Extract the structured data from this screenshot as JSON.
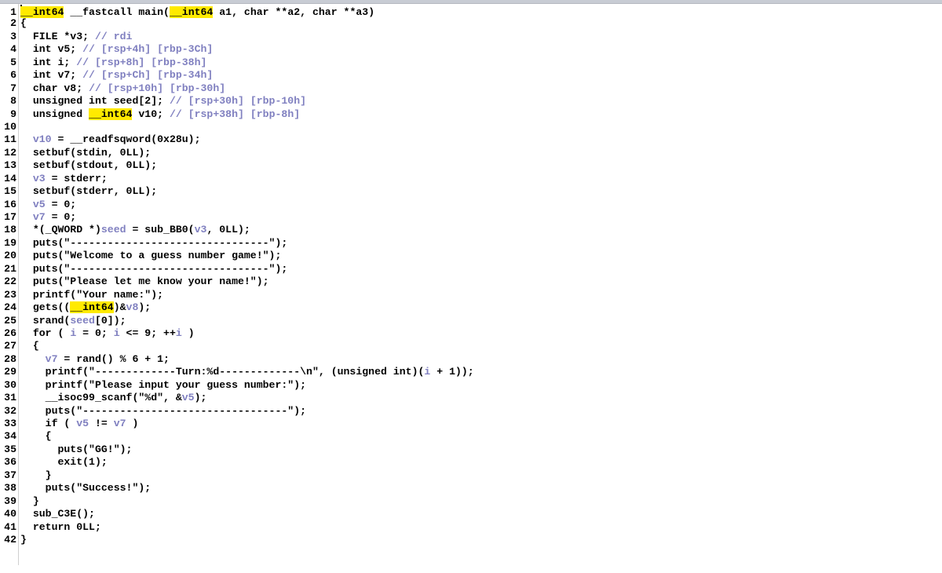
{
  "accent": "#ffea00",
  "comment_color": "#8080c0",
  "lines": [
    {
      "n": "1",
      "segs": [
        [
          "h",
          "__int64"
        ],
        [
          "k",
          " __fastcall main("
        ],
        [
          "h",
          "__int64"
        ],
        [
          "k",
          " a1, char **a2, char **a3)"
        ]
      ]
    },
    {
      "n": "2",
      "segs": [
        [
          "k",
          "{"
        ]
      ]
    },
    {
      "n": "3",
      "segs": [
        [
          "k",
          "  FILE *v3; "
        ],
        [
          "c",
          "// rdi"
        ]
      ]
    },
    {
      "n": "4",
      "segs": [
        [
          "k",
          "  int v5; "
        ],
        [
          "c",
          "// [rsp+4h] [rbp-3Ch]"
        ]
      ]
    },
    {
      "n": "5",
      "segs": [
        [
          "k",
          "  int i; "
        ],
        [
          "c",
          "// [rsp+8h] [rbp-38h]"
        ]
      ]
    },
    {
      "n": "6",
      "segs": [
        [
          "k",
          "  int v7; "
        ],
        [
          "c",
          "// [rsp+Ch] [rbp-34h]"
        ]
      ]
    },
    {
      "n": "7",
      "segs": [
        [
          "k",
          "  char v8; "
        ],
        [
          "c",
          "// [rsp+10h] [rbp-30h]"
        ]
      ]
    },
    {
      "n": "8",
      "segs": [
        [
          "k",
          "  unsigned int seed[2]; "
        ],
        [
          "c",
          "// [rsp+30h] [rbp-10h]"
        ]
      ]
    },
    {
      "n": "9",
      "segs": [
        [
          "k",
          "  unsigned "
        ],
        [
          "h",
          "__int64"
        ],
        [
          "k",
          " v10; "
        ],
        [
          "c",
          "// [rsp+38h] [rbp-8h]"
        ]
      ]
    },
    {
      "n": "10",
      "segs": [
        [
          "k",
          ""
        ]
      ]
    },
    {
      "n": "11",
      "segs": [
        [
          "k",
          "  "
        ],
        [
          "v",
          "v10"
        ],
        [
          "k",
          " = __readfsqword(0x28u);"
        ]
      ]
    },
    {
      "n": "12",
      "segs": [
        [
          "k",
          "  setbuf(stdin, 0LL);"
        ]
      ]
    },
    {
      "n": "13",
      "segs": [
        [
          "k",
          "  setbuf(stdout, 0LL);"
        ]
      ]
    },
    {
      "n": "14",
      "segs": [
        [
          "k",
          "  "
        ],
        [
          "v",
          "v3"
        ],
        [
          "k",
          " = stderr;"
        ]
      ]
    },
    {
      "n": "15",
      "segs": [
        [
          "k",
          "  setbuf(stderr, 0LL);"
        ]
      ]
    },
    {
      "n": "16",
      "segs": [
        [
          "k",
          "  "
        ],
        [
          "v",
          "v5"
        ],
        [
          "k",
          " = 0;"
        ]
      ]
    },
    {
      "n": "17",
      "segs": [
        [
          "k",
          "  "
        ],
        [
          "v",
          "v7"
        ],
        [
          "k",
          " = 0;"
        ]
      ]
    },
    {
      "n": "18",
      "segs": [
        [
          "k",
          "  *(_QWORD *)"
        ],
        [
          "v",
          "seed"
        ],
        [
          "k",
          " = sub_BB0("
        ],
        [
          "v",
          "v3"
        ],
        [
          "k",
          ", 0LL);"
        ]
      ]
    },
    {
      "n": "19",
      "segs": [
        [
          "k",
          "  puts(\"--------------------------------\");"
        ]
      ]
    },
    {
      "n": "20",
      "segs": [
        [
          "k",
          "  puts(\"Welcome to a guess number game!\");"
        ]
      ]
    },
    {
      "n": "21",
      "segs": [
        [
          "k",
          "  puts(\"--------------------------------\");"
        ]
      ]
    },
    {
      "n": "22",
      "segs": [
        [
          "k",
          "  puts(\"Please let me know your name!\");"
        ]
      ]
    },
    {
      "n": "23",
      "segs": [
        [
          "k",
          "  printf(\"Your name:\");"
        ]
      ]
    },
    {
      "n": "24",
      "segs": [
        [
          "k",
          "  gets(("
        ],
        [
          "h",
          "__int64"
        ],
        [
          "k",
          ")&"
        ],
        [
          "v",
          "v8"
        ],
        [
          "k",
          ");"
        ]
      ]
    },
    {
      "n": "25",
      "segs": [
        [
          "k",
          "  srand("
        ],
        [
          "v",
          "seed"
        ],
        [
          "k",
          "[0]);"
        ]
      ]
    },
    {
      "n": "26",
      "segs": [
        [
          "k",
          "  for ( "
        ],
        [
          "v",
          "i"
        ],
        [
          "k",
          " = 0; "
        ],
        [
          "v",
          "i"
        ],
        [
          "k",
          " <= 9; ++"
        ],
        [
          "v",
          "i"
        ],
        [
          "k",
          " )"
        ]
      ]
    },
    {
      "n": "27",
      "segs": [
        [
          "k",
          "  {"
        ]
      ]
    },
    {
      "n": "28",
      "segs": [
        [
          "k",
          "    "
        ],
        [
          "v",
          "v7"
        ],
        [
          "k",
          " = rand() % 6 + 1;"
        ]
      ]
    },
    {
      "n": "29",
      "segs": [
        [
          "k",
          "    printf(\"-------------Turn:%d-------------\\n\", (unsigned int)("
        ],
        [
          "v",
          "i"
        ],
        [
          "k",
          " + 1));"
        ]
      ]
    },
    {
      "n": "30",
      "segs": [
        [
          "k",
          "    printf(\"Please input your guess number:\");"
        ]
      ]
    },
    {
      "n": "31",
      "segs": [
        [
          "k",
          "    __isoc99_scanf(\"%d\", &"
        ],
        [
          "v",
          "v5"
        ],
        [
          "k",
          ");"
        ]
      ]
    },
    {
      "n": "32",
      "segs": [
        [
          "k",
          "    puts(\"---------------------------------\");"
        ]
      ]
    },
    {
      "n": "33",
      "segs": [
        [
          "k",
          "    if ( "
        ],
        [
          "v",
          "v5"
        ],
        [
          "k",
          " != "
        ],
        [
          "v",
          "v7"
        ],
        [
          "k",
          " )"
        ]
      ]
    },
    {
      "n": "34",
      "segs": [
        [
          "k",
          "    {"
        ]
      ]
    },
    {
      "n": "35",
      "segs": [
        [
          "k",
          "      puts(\"GG!\");"
        ]
      ]
    },
    {
      "n": "36",
      "segs": [
        [
          "k",
          "      exit(1);"
        ]
      ]
    },
    {
      "n": "37",
      "segs": [
        [
          "k",
          "    }"
        ]
      ]
    },
    {
      "n": "38",
      "segs": [
        [
          "k",
          "    puts(\"Success!\");"
        ]
      ]
    },
    {
      "n": "39",
      "segs": [
        [
          "k",
          "  }"
        ]
      ]
    },
    {
      "n": "40",
      "segs": [
        [
          "k",
          "  sub_C3E();"
        ]
      ]
    },
    {
      "n": "41",
      "segs": [
        [
          "k",
          "  return 0LL;"
        ]
      ]
    },
    {
      "n": "42",
      "segs": [
        [
          "k",
          "}"
        ]
      ]
    }
  ]
}
